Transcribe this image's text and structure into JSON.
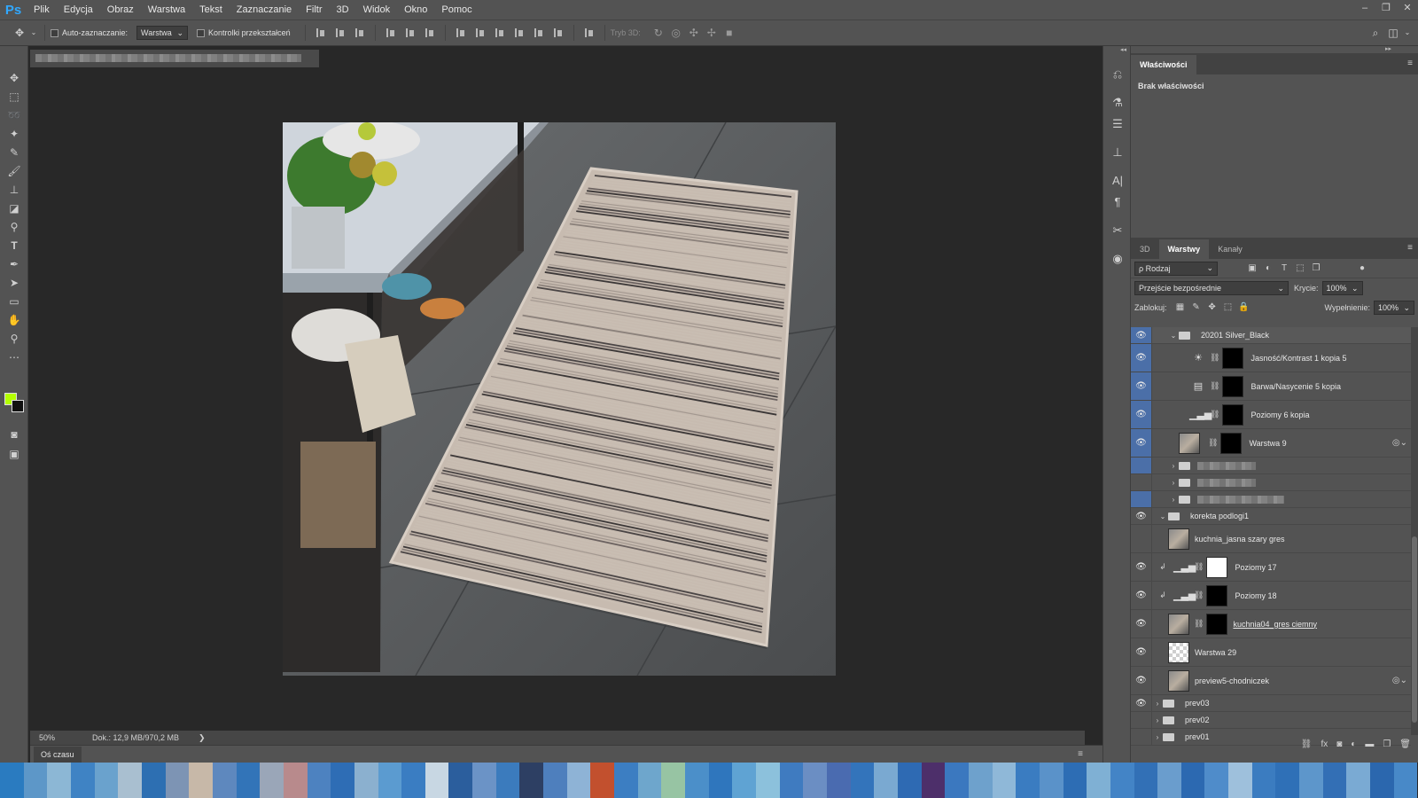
{
  "app": {
    "logo": "Ps"
  },
  "menu": [
    "Plik",
    "Edycja",
    "Obraz",
    "Warstwa",
    "Tekst",
    "Zaznaczanie",
    "Filtr",
    "3D",
    "Widok",
    "Okno",
    "Pomoc"
  ],
  "window_controls": [
    "–",
    "❐",
    "✕"
  ],
  "options": {
    "auto_select_label": "Auto-zaznaczanie:",
    "auto_select_value": "Warstwa",
    "transform_label": "Kontrolki przekształceń",
    "mode3d_label": "Tryb 3D:"
  },
  "status": {
    "zoom": "50%",
    "doc": "Dok.: 12,9 MB/970,2 MB",
    "arrow": "❯"
  },
  "timeline": {
    "tab": "Oś czasu"
  },
  "properties": {
    "tab": "Właściwości",
    "empty": "Brak właściwości"
  },
  "layers_panel": {
    "tabs": [
      "3D",
      "Warstwy",
      "Kanały"
    ],
    "filter_kind": "ρ Rodzaj",
    "blend_mode": "Przejście bezpośrednie",
    "opacity_label": "Krycie:",
    "opacity_value": "100%",
    "lock_label": "Zablokuj:",
    "fill_label": "Wypełnienie:",
    "fill_value": "100%",
    "layers": [
      {
        "name": "20201 Silver_Black"
      },
      {
        "name": "Jasność/Kontrast 1 kopia 5"
      },
      {
        "name": "Barwa/Nasycenie 5 kopia"
      },
      {
        "name": "Poziomy 6 kopia"
      },
      {
        "name": "Warstwa 9"
      },
      {
        "name": "korekta podlogi1"
      },
      {
        "name": "kuchnia_jasna szary gres"
      },
      {
        "name": "Poziomy 17"
      },
      {
        "name": "Poziomy 18"
      },
      {
        "name": "kuchnia04_gres ciemny"
      },
      {
        "name": "Warstwa 29"
      },
      {
        "name": "preview5-chodniczek"
      },
      {
        "name": "prev03"
      },
      {
        "name": "prev02"
      },
      {
        "name": "prev01"
      }
    ]
  },
  "colors": {
    "foreground": "#b4ff00",
    "background": "#111111",
    "selection": "#4b6fa8",
    "accent": "#31a8ff"
  },
  "taskbar_colors": [
    "#2a7bc0",
    "#5d97c8",
    "#8cb7d5",
    "#3f83c4",
    "#6aa2cd",
    "#a9bfd0",
    "#2d6fb2",
    "#7d94b4",
    "#c7b8a8",
    "#5e88be",
    "#3274b8",
    "#9aa6b8",
    "#b88a8c",
    "#4d82c0",
    "#2e6db5",
    "#8bb0cf",
    "#5b9bd0",
    "#3a7dc2",
    "#c8d7e3",
    "#2b5e9d",
    "#6b93c6",
    "#3b7bbd",
    "#2d3f63",
    "#4e7fbd",
    "#8eb3d6",
    "#c2502e",
    "#3c7ec2",
    "#6ea6cc",
    "#97c4a3",
    "#4b8fc9",
    "#2f76bd",
    "#5fa3d3",
    "#8cc1dc",
    "#3f7bc0",
    "#6b8ec3",
    "#4a6bb0",
    "#3374bb",
    "#7aa9d1",
    "#2e6ab3",
    "#4d2f6a",
    "#3b78bf",
    "#6ea1cc",
    "#8fb8d8",
    "#3a7cc1",
    "#5a92c9",
    "#2d6db4",
    "#7fb0d4",
    "#4384c6",
    "#3270b6",
    "#6a9dcd",
    "#2c69b1",
    "#4f8cca",
    "#9ec0dc",
    "#3b7cc0",
    "#2f70b7",
    "#5d96cb",
    "#336fb5",
    "#7aaad3",
    "#2b67ae",
    "#4889c8"
  ]
}
